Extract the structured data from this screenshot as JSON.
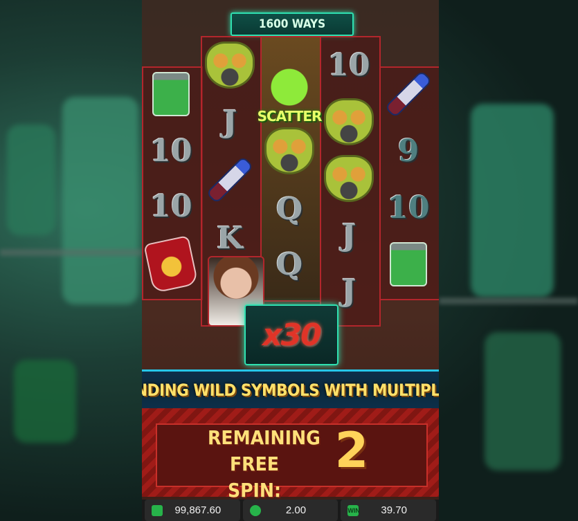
{
  "game": {
    "ways_label": "1600 WAYS",
    "banner_text": "PANDING WILD SYMBOLS WITH MULTIPLIER",
    "multiplier": "x30",
    "scatter_label": "SCATTER",
    "free_spin_label_line1": "REMAINING",
    "free_spin_label_line2": "FREE SPIN:",
    "free_spins_remaining": "2"
  },
  "reels": {
    "col1": [
      "jar",
      "10",
      "10",
      "blood-bag"
    ],
    "col2": [
      "mask",
      "J",
      "tube",
      "K",
      "avatar"
    ],
    "col3": [
      "scatter",
      "mask",
      "Q",
      "Q"
    ],
    "col4": [
      "10",
      "mask",
      "mask",
      "J",
      "J"
    ],
    "col5": [
      "tube",
      "9",
      "10",
      "jar"
    ]
  },
  "status_bar": {
    "balance": "99,867.60",
    "bet": "2.00",
    "win": "39.70",
    "win_icon_text": "WIN"
  },
  "colors": {
    "accent_teal": "#2fe0b0",
    "reel_border_red": "#b3262c",
    "banner_blue": "#26c6e8",
    "text_gold": "#ffe16a"
  }
}
